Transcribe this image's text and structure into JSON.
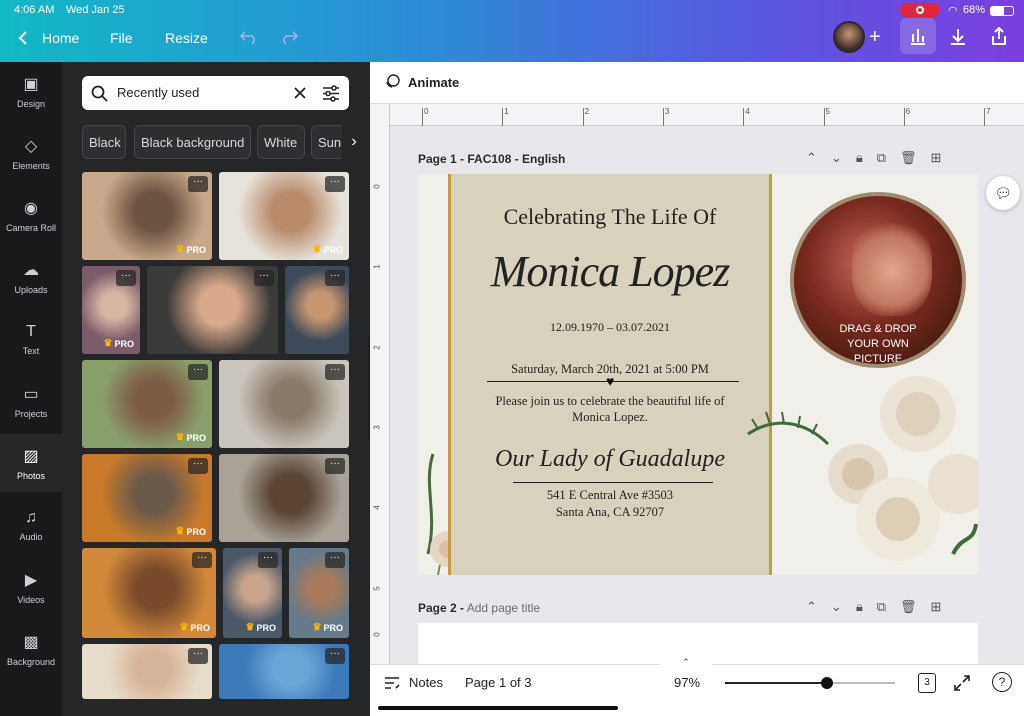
{
  "status": {
    "time": "4:06 AM",
    "date": "Wed Jan 25",
    "battery": "68%"
  },
  "topbar": {
    "home": "Home",
    "file": "File",
    "resize": "Resize"
  },
  "rail": [
    {
      "label": "Design",
      "icon": "design-icon"
    },
    {
      "label": "Elements",
      "icon": "elements-icon"
    },
    {
      "label": "Camera Roll",
      "icon": "camera-icon"
    },
    {
      "label": "Uploads",
      "icon": "upload-icon"
    },
    {
      "label": "Text",
      "icon": "text-icon"
    },
    {
      "label": "Projects",
      "icon": "folder-icon"
    },
    {
      "label": "Photos",
      "icon": "photos-icon"
    },
    {
      "label": "Audio",
      "icon": "audio-icon"
    },
    {
      "label": "Videos",
      "icon": "video-icon"
    },
    {
      "label": "Background",
      "icon": "background-icon"
    }
  ],
  "search": {
    "value": "Recently used"
  },
  "chips": [
    "Black",
    "Black background",
    "White",
    "Sunrise"
  ],
  "photos": {
    "pro": "PRO",
    "dots": "···"
  },
  "editor": {
    "animate": "Animate",
    "page1_title": "Page 1 - FAC108 - English",
    "page2_title": "Page 2 -",
    "page2_placeholder": "Add page title"
  },
  "ruler": {
    "h": [
      "0",
      "1",
      "2",
      "3",
      "4",
      "5",
      "6",
      "7"
    ],
    "v": [
      "0",
      "1",
      "2",
      "3",
      "4",
      "5",
      "0"
    ]
  },
  "card": {
    "heading": "Celebrating The Life Of",
    "name": "Monica Lopez",
    "dates": "12.09.1970 – 03.07.2021",
    "service": "Saturday, March 20th, 2021 at 5:00 PM",
    "invite1": "Please join us to celebrate the beautiful life of",
    "invite2": "Monica Lopez.",
    "venue": "Our Lady of Guadalupe",
    "addr1": "541 E Central Ave #3503",
    "addr2": "Santa Ana, CA 92707",
    "photo_text1": "DRAG & DROP",
    "photo_text2": "YOUR OWN",
    "photo_text3": "PICTURE"
  },
  "bottom": {
    "notes": "Notes",
    "page": "Page 1 of 3",
    "zoom": "97%",
    "pages_count": "3",
    "zoom_level": 0.6
  }
}
